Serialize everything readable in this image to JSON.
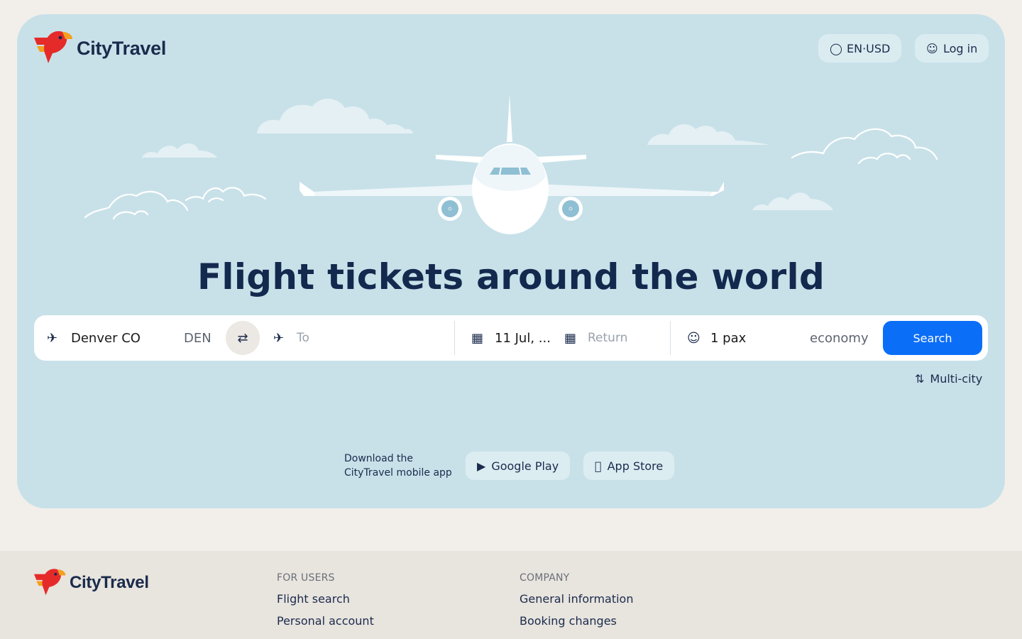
{
  "brand": {
    "name": "CityTravel"
  },
  "header": {
    "lang_currency": "EN·USD",
    "login_label": "Log in",
    "globe_icon": "globe-icon",
    "user_icon": "user-icon"
  },
  "hero": {
    "headline": "Flight tickets around the world"
  },
  "search": {
    "from_value": "Denver CO",
    "from_code": "DEN",
    "to_placeholder": "To",
    "depart_value": "11 Jul, ...",
    "return_placeholder": "Return",
    "passengers": "1 pax",
    "cabin_class": "economy",
    "search_label": "Search"
  },
  "multi_city_label": "Multi-city",
  "app_promo": {
    "line1": "Download the",
    "line2": "CityTravel mobile app",
    "google_play": "Google Play",
    "app_store": "App Store"
  },
  "footer": {
    "brand": "CityTravel",
    "for_users": {
      "heading": "FOR USERS",
      "links": [
        "Flight search",
        "Personal account"
      ]
    },
    "company": {
      "heading": "COMPANY",
      "links": [
        "General information",
        "Booking changes"
      ]
    }
  },
  "colors": {
    "hero_bg": "#c8e1e9",
    "page_bg": "#f2efea",
    "accent": "#0b6ef7",
    "headline": "#13294e"
  }
}
